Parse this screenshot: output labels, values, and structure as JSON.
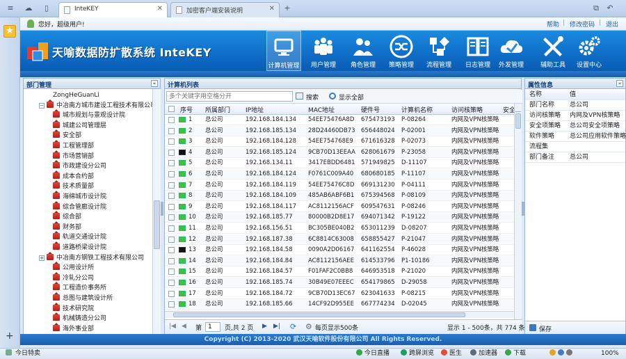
{
  "browser": {
    "tabs": [
      {
        "label": "InteKEY",
        "active": true
      },
      {
        "label": "加密客户端安装说明",
        "active": false
      }
    ]
  },
  "greeting": "您好，超级用户!",
  "top_links": [
    "帮助",
    "修改密码",
    "退出"
  ],
  "brand": {
    "title": "天喻数据防扩散系统 InteKEY"
  },
  "nav": [
    {
      "label": "计算机管理",
      "icon": "monitor-icon",
      "active": true
    },
    {
      "label": "用户管理",
      "icon": "users-icon",
      "active": false
    },
    {
      "label": "角色管理",
      "icon": "role-icon",
      "active": false
    },
    {
      "label": "策略管理",
      "icon": "shuffle-icon",
      "active": false
    },
    {
      "label": "流程管理",
      "icon": "flow-icon",
      "active": false
    },
    {
      "label": "日志管理",
      "icon": "book-icon",
      "active": false
    },
    {
      "label": "外发管理",
      "icon": "cloud-icon",
      "active": false
    },
    {
      "label": "辅助工具",
      "icon": "tools-icon",
      "active": false
    },
    {
      "label": "设置中心",
      "icon": "gears-icon",
      "active": false
    }
  ],
  "dept_panel": {
    "title": "部门管理",
    "items": [
      {
        "label": "ZongHeGuanLi",
        "level": 2,
        "icon": false,
        "expander": false
      },
      {
        "label": "中冶南方城市建设工程技术有限公司",
        "level": 1,
        "icon": true,
        "expander": "−"
      },
      {
        "label": "城市规划与景观设计院",
        "level": 2,
        "icon": true,
        "expander": false
      },
      {
        "label": "城建公司管理层",
        "level": 2,
        "icon": true,
        "expander": false
      },
      {
        "label": "安全部",
        "level": 2,
        "icon": true,
        "expander": false
      },
      {
        "label": "工程管理部",
        "level": 2,
        "icon": true,
        "expander": false
      },
      {
        "label": "市场营销部",
        "level": 2,
        "icon": true,
        "expander": false
      },
      {
        "label": "市政建设分公司",
        "level": 2,
        "icon": true,
        "expander": false
      },
      {
        "label": "成本合约部",
        "level": 2,
        "icon": true,
        "expander": false
      },
      {
        "label": "技术质量部",
        "level": 2,
        "icon": true,
        "expander": false
      },
      {
        "label": "海绵城市设计院",
        "level": 2,
        "icon": true,
        "expander": false
      },
      {
        "label": "综合管廊设计院",
        "level": 2,
        "icon": true,
        "expander": false
      },
      {
        "label": "综合部",
        "level": 2,
        "icon": true,
        "expander": false
      },
      {
        "label": "财务部",
        "level": 2,
        "icon": true,
        "expander": false
      },
      {
        "label": "轨道交通设计院",
        "level": 2,
        "icon": true,
        "expander": false
      },
      {
        "label": "道路桥梁设计院",
        "level": 2,
        "icon": true,
        "expander": false
      },
      {
        "label": "中冶南方钢铁工程技术有限公司",
        "level": 1,
        "icon": true,
        "expander": "+"
      },
      {
        "label": "公用设计所",
        "level": 2,
        "icon": true,
        "expander": false
      },
      {
        "label": "冷轧分公司",
        "level": 2,
        "icon": true,
        "expander": false
      },
      {
        "label": "工程造价事务所",
        "level": 2,
        "icon": true,
        "expander": false
      },
      {
        "label": "总图与建筑设计所",
        "level": 2,
        "icon": true,
        "expander": false
      },
      {
        "label": "技术研究院",
        "level": 2,
        "icon": true,
        "expander": false
      },
      {
        "label": "机械铸造分公司",
        "level": 2,
        "icon": true,
        "expander": false
      },
      {
        "label": "海外事业部",
        "level": 2,
        "icon": true,
        "expander": false
      }
    ]
  },
  "computer_list": {
    "title": "计算机列表",
    "search_placeholder": "多个关键字用空格分开",
    "search_button": "搜索",
    "show_all_button": "显示全部",
    "columns": [
      "序号",
      "所属部门",
      "IP地址",
      "MAC地址",
      "硬件号",
      "计算机名称",
      "访问核策略",
      "安全项"
    ],
    "rows": [
      {
        "no": "1",
        "dept": "总公司",
        "ip": "192.168.184.134",
        "mac": "54EE75476A8D",
        "hw": "675473193",
        "name": "P-08264",
        "policy": "内网及VPN核策略",
        "online": true
      },
      {
        "no": "2",
        "dept": "总公司",
        "ip": "192.168.185.134",
        "mac": "28D24460DB73",
        "hw": "656448024",
        "name": "P-02001",
        "policy": "内网及VPN核策略",
        "online": true
      },
      {
        "no": "3",
        "dept": "总公司",
        "ip": "192.168.184.128",
        "mac": "54EE754768E9",
        "hw": "671616328",
        "name": "P-02073",
        "policy": "内网及VPN核策略",
        "online": true
      },
      {
        "no": "4",
        "dept": "总公司",
        "ip": "192.168.185.124",
        "mac": "9CB70D13EEAA",
        "hw": "628061679",
        "name": "P-23058",
        "policy": "内网及VPN核策略",
        "online": false
      },
      {
        "no": "5",
        "dept": "总公司",
        "ip": "192.168.134.11",
        "mac": "3417EBDD6481",
        "hw": "571949825",
        "name": "D-11107",
        "policy": "内网及VPN核策略",
        "online": true
      },
      {
        "no": "6",
        "dept": "总公司",
        "ip": "192.168.184.124",
        "mac": "F0761C009A40",
        "hw": "680680185",
        "name": "P-11107",
        "policy": "内网及VPN核策略",
        "online": true
      },
      {
        "no": "7",
        "dept": "总公司",
        "ip": "192.168.184.119",
        "mac": "54EE75476C8D",
        "hw": "669131230",
        "name": "P-04111",
        "policy": "内网及VPN核策略",
        "online": true
      },
      {
        "no": "8",
        "dept": "总公司",
        "ip": "192.168.184.109",
        "mac": "485AB6ABF6B1",
        "hw": "675394568",
        "name": "P-08109",
        "policy": "内网及VPN核策略",
        "online": true
      },
      {
        "no": "9",
        "dept": "总公司",
        "ip": "192.168.184.117",
        "mac": "AC8112156ACF",
        "hw": "609547631",
        "name": "P-08246",
        "policy": "内网及VPN核策略",
        "online": true
      },
      {
        "no": "10",
        "dept": "总公司",
        "ip": "192.168.185.77",
        "mac": "80000B2D8E17",
        "hw": "694071342",
        "name": "P-19122",
        "policy": "内网及VPN核策略",
        "online": true
      },
      {
        "no": "11",
        "dept": "总公司",
        "ip": "192.168.156.51",
        "mac": "BC305BE040B2",
        "hw": "653011239",
        "name": "D-08207",
        "policy": "内网及VPN核策略",
        "online": true
      },
      {
        "no": "12",
        "dept": "总公司",
        "ip": "192.168.187.38",
        "mac": "6C8814C63008",
        "hw": "658855427",
        "name": "P-21047",
        "policy": "内网及VPN核策略",
        "online": true
      },
      {
        "no": "13",
        "dept": "总公司",
        "ip": "192.168.184.58",
        "mac": "0090A2D06167",
        "hw": "641162554",
        "name": "P-46028",
        "policy": "内网及VPN核策略",
        "online": false
      },
      {
        "no": "14",
        "dept": "总公司",
        "ip": "192.168.184.84",
        "mac": "AC8112156AEE",
        "hw": "614533796",
        "name": "P1-10186",
        "policy": "内网及VPN核策略",
        "online": true
      },
      {
        "no": "15",
        "dept": "总公司",
        "ip": "192.168.184.57",
        "mac": "F01FAF2C0BB8",
        "hw": "646953518",
        "name": "P-21020",
        "policy": "内网及VPN核策略",
        "online": true
      },
      {
        "no": "16",
        "dept": "总公司",
        "ip": "192.168.185.74",
        "mac": "30B49E07EEEC",
        "hw": "654179865",
        "name": "D-29058",
        "policy": "内网及VPN核策略",
        "online": true
      },
      {
        "no": "17",
        "dept": "总公司",
        "ip": "192.168.184.72",
        "mac": "9CB70D13EC67",
        "hw": "623041633",
        "name": "P-08215",
        "policy": "内网及VPN核策略",
        "online": true
      },
      {
        "no": "18",
        "dept": "总公司",
        "ip": "192.168.185.66",
        "mac": "14CF92D955EE",
        "hw": "667774234",
        "name": "D-02045",
        "policy": "内网及VPN核策略",
        "online": true
      }
    ],
    "pager": {
      "page_label": "第",
      "page_value": "1",
      "page_total": "页,共 2 页",
      "per_page": "每页显示500条",
      "summary": "显示 1 - 500条，共 774 条"
    }
  },
  "props_panel": {
    "title": "属性信息",
    "columns": [
      "名称",
      "值"
    ],
    "rows": [
      {
        "name": "部门名称",
        "value": "总公司"
      },
      {
        "name": "访问核策略",
        "value": "内网及VPN核策略"
      },
      {
        "name": "安全项策略",
        "value": "总公司安全项策略"
      },
      {
        "name": "软件策略",
        "value": "总公司应用软件策略"
      },
      {
        "name": "流程集",
        "value": ""
      },
      {
        "name": "部门备注",
        "value": "总公司"
      }
    ],
    "save_button": "保存"
  },
  "footer": "Copyright (C) 2013-2020 武汉天喻软件股份有限公司  All Rights Reserved.",
  "statusbar": {
    "left": "今日特卖",
    "items": [
      "今日直播",
      "跨屏浏览",
      "医生",
      "加速器",
      "下载"
    ],
    "zoom": "100%"
  },
  "colors": {
    "brand_blue": "#0f6fc9",
    "online_green": "#3cc23c",
    "offline_black": "#111111"
  }
}
